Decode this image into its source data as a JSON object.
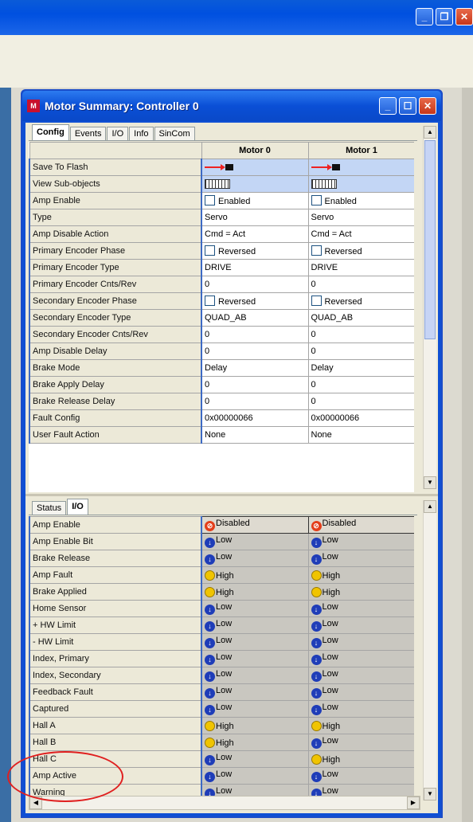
{
  "window": {
    "title": "Motor Summary: Controller 0",
    "app_icon": "controller-app-icon"
  },
  "config_tabs": [
    "Config",
    "Events",
    "I/O",
    "Info",
    "SinCom"
  ],
  "status_tabs": [
    "Status",
    "I/O"
  ],
  "columns": [
    "Motor 0",
    "Motor 1"
  ],
  "config_rows": [
    {
      "label": "Save To Flash",
      "type": "arrow"
    },
    {
      "label": "View Sub-objects",
      "type": "subobj"
    },
    {
      "label": "Amp Enable",
      "type": "check",
      "m0": "Enabled",
      "m1": "Enabled"
    },
    {
      "label": "Type",
      "m0": "Servo",
      "m1": "Servo"
    },
    {
      "label": "Amp Disable Action",
      "m0": "Cmd = Act",
      "m1": "Cmd = Act"
    },
    {
      "label": "Primary Encoder Phase",
      "type": "check",
      "m0": "Reversed",
      "m1": "Reversed"
    },
    {
      "label": "Primary Encoder Type",
      "m0": "DRIVE",
      "m1": "DRIVE"
    },
    {
      "label": "Primary Encoder Cnts/Rev",
      "m0": "0",
      "m1": "0"
    },
    {
      "label": "Secondary Encoder Phase",
      "type": "check",
      "m0": "Reversed",
      "m1": "Reversed"
    },
    {
      "label": "Secondary Encoder Type",
      "m0": "QUAD_AB",
      "m1": "QUAD_AB"
    },
    {
      "label": "Secondary Encoder Cnts/Rev",
      "m0": "0",
      "m1": "0"
    },
    {
      "label": "Amp Disable Delay",
      "m0": "0",
      "m1": "0"
    },
    {
      "label": "Brake Mode",
      "m0": "Delay",
      "m1": "Delay"
    },
    {
      "label": "Brake Apply Delay",
      "m0": "0",
      "m1": "0"
    },
    {
      "label": "Brake Release Delay",
      "m0": "0",
      "m1": "0"
    },
    {
      "label": "Fault Config",
      "m0": "0x00000066",
      "m1": "0x00000066"
    },
    {
      "label": "User Fault Action",
      "m0": "None",
      "m1": "None"
    }
  ],
  "status_rows": [
    {
      "label": "Amp Enable",
      "m0": "Disabled",
      "m1": "Disabled"
    },
    {
      "label": "Amp Enable Bit",
      "m0": "Low",
      "m1": "Low"
    },
    {
      "label": "Brake Release",
      "m0": "Low",
      "m1": "Low"
    },
    {
      "label": "Amp Fault",
      "m0": "High",
      "m1": "High"
    },
    {
      "label": "Brake Applied",
      "m0": "High",
      "m1": "High"
    },
    {
      "label": "Home Sensor",
      "m0": "Low",
      "m1": "Low"
    },
    {
      "label": "+ HW Limit",
      "m0": "Low",
      "m1": "Low"
    },
    {
      "label": "- HW Limit",
      "m0": "Low",
      "m1": "Low"
    },
    {
      "label": "Index, Primary",
      "m0": "Low",
      "m1": "Low"
    },
    {
      "label": "Index, Secondary",
      "m0": "Low",
      "m1": "Low"
    },
    {
      "label": "Feedback Fault",
      "m0": "Low",
      "m1": "Low"
    },
    {
      "label": "Captured",
      "m0": "Low",
      "m1": "Low"
    },
    {
      "label": "Hall A",
      "m0": "High",
      "m1": "High"
    },
    {
      "label": "Hall B",
      "m0": "High",
      "m1": "Low"
    },
    {
      "label": "Hall C",
      "m0": "Low",
      "m1": "High"
    },
    {
      "label": "Amp Active",
      "m0": "Low",
      "m1": "Low"
    },
    {
      "label": "Warning",
      "m0": "Low",
      "m1": "Low"
    }
  ],
  "indicator_colors": {
    "low": "#1f3db8",
    "high": "#f0c400",
    "disabled": "#e43e1a"
  }
}
